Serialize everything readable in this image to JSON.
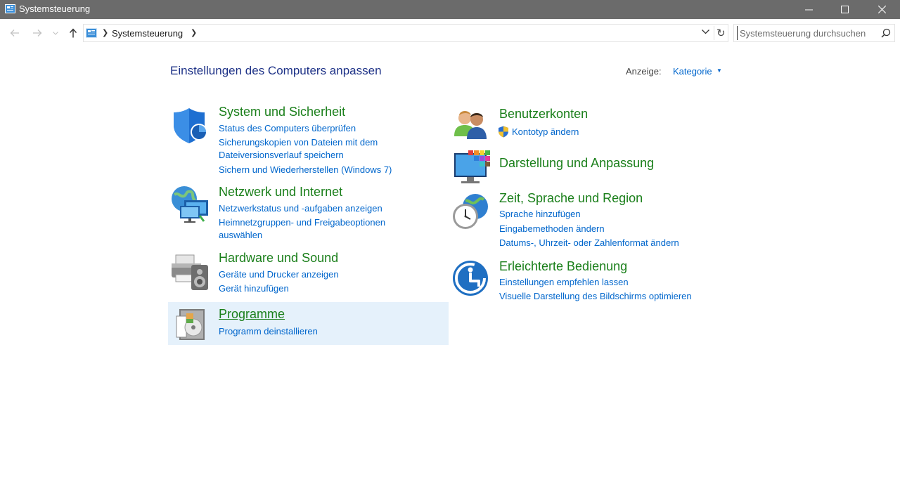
{
  "window": {
    "title": "Systemsteuerung",
    "colors": {
      "titlebar": "#6b6b6b",
      "accent_link": "#0066cc",
      "category_title": "#1a7f1a",
      "heading": "#1e3287",
      "hover_bg": "#e5f1fb"
    }
  },
  "address": {
    "breadcrumb": "Systemsteuerung"
  },
  "search": {
    "placeholder": "Systemsteuerung durchsuchen"
  },
  "main": {
    "heading": "Einstellungen des Computers anpassen",
    "view_label": "Anzeige:",
    "view_value": "Kategorie"
  },
  "categories_left": [
    {
      "title": "System und Sicherheit",
      "icon": "shield-icon",
      "links": [
        "Status des Computers überprüfen",
        "Sicherungskopien von Dateien mit dem",
        "Dateiversionsverlauf speichern",
        "Sichern und Wiederherstellen (Windows 7)"
      ]
    },
    {
      "title": "Netzwerk und Internet",
      "icon": "network-globe-icon",
      "links": [
        "Netzwerkstatus und -aufgaben anzeigen",
        "Heimnetzgruppen- und Freigabeoptionen",
        "auswählen"
      ]
    },
    {
      "title": "Hardware und Sound",
      "icon": "printer-speaker-icon",
      "links": [
        "Geräte und Drucker anzeigen",
        "Gerät hinzufügen"
      ]
    },
    {
      "title": "Programme",
      "icon": "programs-disc-icon",
      "links": [
        "Programm deinstallieren"
      ]
    }
  ],
  "categories_right": [
    {
      "title": "Benutzerkonten",
      "icon": "users-icon",
      "links": [
        "Kontotyp ändern"
      ]
    },
    {
      "title": "Darstellung und Anpassung",
      "icon": "monitor-palette-icon",
      "links": []
    },
    {
      "title": "Zeit, Sprache und Region",
      "icon": "clock-globe-icon",
      "links": [
        "Sprache hinzufügen",
        "Eingabemethoden ändern",
        "Datums-, Uhrzeit- oder Zahlenformat ändern"
      ]
    },
    {
      "title": "Erleichterte Bedienung",
      "icon": "ease-of-access-icon",
      "links": [
        "Einstellungen empfehlen lassen",
        "Visuelle Darstellung des Bildschirms optimieren"
      ]
    }
  ]
}
